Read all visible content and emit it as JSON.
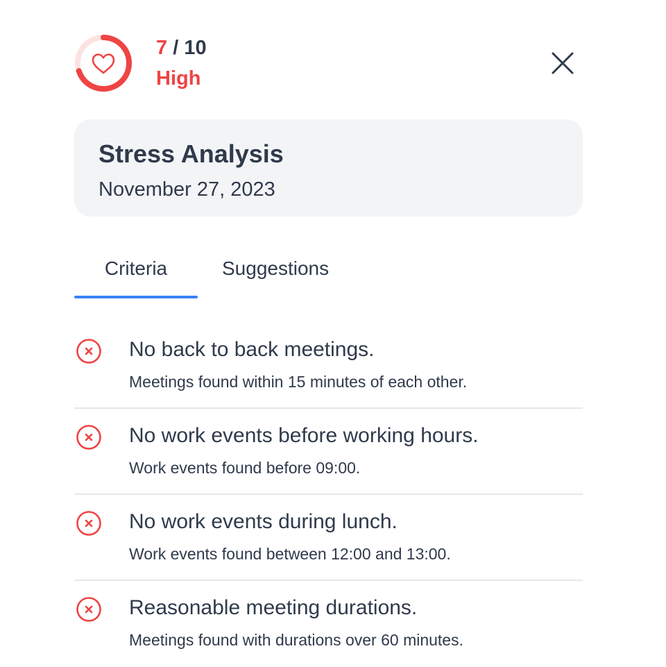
{
  "header": {
    "score_value": "7",
    "score_separator": " / ",
    "score_max": "10",
    "score_fraction": 0.7,
    "level": "High",
    "ring_icon": "heart-icon",
    "close_icon": "close-icon"
  },
  "summary": {
    "title": "Stress Analysis",
    "date": "November 27, 2023"
  },
  "tabs": [
    {
      "label": "Criteria",
      "active": true
    },
    {
      "label": "Suggestions",
      "active": false
    }
  ],
  "criteria": [
    {
      "title": "No back to back meetings.",
      "detail": "Meetings found within 15 minutes of each other.",
      "status": "failed",
      "icon": "x-circle-icon"
    },
    {
      "title": "No work events before working hours.",
      "detail": "Work events found before 09:00.",
      "status": "failed",
      "icon": "x-circle-icon"
    },
    {
      "title": "No work events during lunch.",
      "detail": "Work events found between 12:00 and 13:00.",
      "status": "failed",
      "icon": "x-circle-icon"
    },
    {
      "title": "Reasonable meeting durations.",
      "detail": "Meetings found with durations over 60 minutes.",
      "status": "failed",
      "icon": "x-circle-icon"
    }
  ],
  "colors": {
    "accent_red": "#ef4444",
    "ring_track": "#fde2e2",
    "tab_active": "#3b82f6",
    "text": "#2f3a4b",
    "card_bg": "#f3f4f6"
  }
}
